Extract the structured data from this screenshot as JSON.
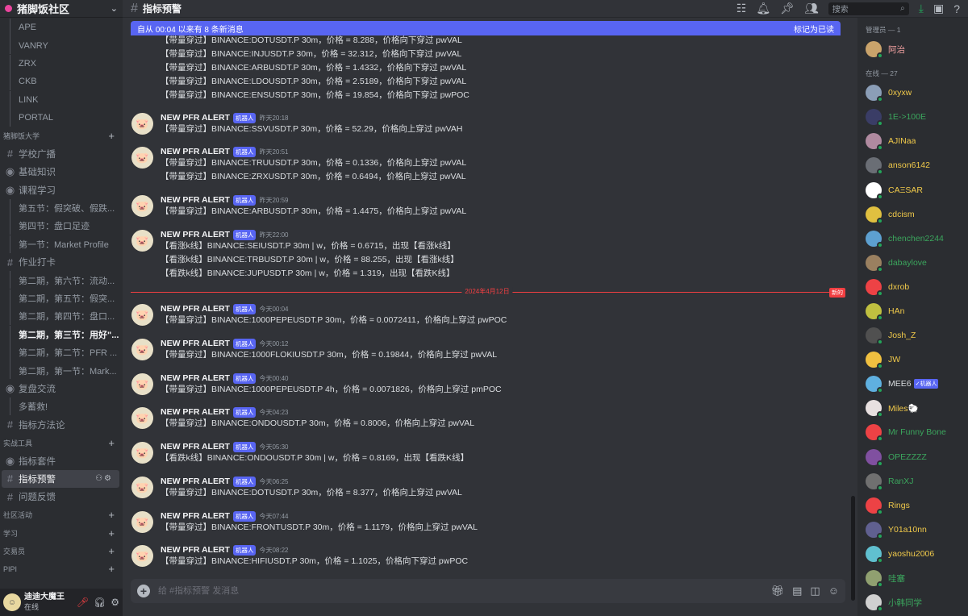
{
  "server": {
    "name": "猪脚饭社区"
  },
  "channels": [
    {
      "kind": "sub",
      "label": "APE"
    },
    {
      "kind": "sub",
      "label": "VANRY"
    },
    {
      "kind": "sub",
      "label": "ZRX"
    },
    {
      "kind": "sub",
      "label": "CKB"
    },
    {
      "kind": "sub",
      "label": "LINK"
    },
    {
      "kind": "sub",
      "label": "PORTAL"
    },
    {
      "kind": "cat",
      "label": "猪脚饭大学"
    },
    {
      "kind": "ch",
      "icon": "#",
      "label": "学校广播"
    },
    {
      "kind": "ch",
      "icon": "◉",
      "label": "基础知识"
    },
    {
      "kind": "ch",
      "icon": "◉",
      "label": "课程学习"
    },
    {
      "kind": "sub",
      "label": "第五节：假突破、假跌..."
    },
    {
      "kind": "sub",
      "label": "第四节：盘口足迹"
    },
    {
      "kind": "sub",
      "label": "第一节：Market Profile"
    },
    {
      "kind": "ch",
      "icon": "#",
      "label": "作业打卡"
    },
    {
      "kind": "sub",
      "label": "第二期，第六节：流动..."
    },
    {
      "kind": "sub",
      "label": "第二期，第五节：假突..."
    },
    {
      "kind": "sub",
      "label": "第二期，第四节：盘口..."
    },
    {
      "kind": "subb",
      "label": "第二期，第三节：用好\"..."
    },
    {
      "kind": "sub",
      "label": "第二期，第二节：PFR ..."
    },
    {
      "kind": "sub",
      "label": "第二期，第一节：Mark..."
    },
    {
      "kind": "ch",
      "icon": "◉",
      "label": "复盘交流"
    },
    {
      "kind": "sub",
      "label": "多蓄救!"
    },
    {
      "kind": "ch",
      "icon": "#",
      "label": "指标方法论"
    },
    {
      "kind": "cat",
      "label": "实战工具"
    },
    {
      "kind": "ch",
      "icon": "◉",
      "label": "指标套件"
    },
    {
      "kind": "sel",
      "icon": "#",
      "label": "指标预警"
    },
    {
      "kind": "ch",
      "icon": "#",
      "label": "问题反馈"
    },
    {
      "kind": "cat",
      "label": "社区活动"
    },
    {
      "kind": "cat",
      "label": "学习"
    },
    {
      "kind": "cat",
      "label": "交易员"
    },
    {
      "kind": "cat",
      "label": "PIPI"
    }
  ],
  "user": {
    "name": "迪迪大魔王",
    "status": "在线"
  },
  "topbar": {
    "channel": "指标预警",
    "search_placeholder": "搜索"
  },
  "banner": {
    "text": "自从 00:04 以来有 8 条新消息",
    "action": "标记为已读"
  },
  "bot_tag": "机器人",
  "top_lines": [
    "【带量穿过】BINANCE:DOTUSDT.P 30m，价格 = 8.288，价格向下穿过 pwVAL",
    "【带量穿过】BINANCE:INJUSDT.P 30m，价格 = 32.312，价格向下穿过 pwVAL",
    "【带量穿过】BINANCE:ARBUSDT.P 30m，价格 = 1.4332，价格向下穿过 pwVAL",
    "【带量穿过】BINANCE:LDOUSDT.P 30m，价格 = 2.5189，价格向下穿过 pwVAL",
    "【带量穿过】BINANCE:ENSUSDT.P 30m，价格 = 19.854，价格向下穿过 pwPOC"
  ],
  "messages": [
    {
      "author": "NEW PFR ALERT",
      "time": "昨天20:18",
      "lines": [
        "【带量穿过】BINANCE:SSVUSDT.P 30m，价格 = 52.29，价格向上穿过 pwVAH"
      ]
    },
    {
      "author": "NEW PFR ALERT",
      "time": "昨天20:51",
      "lines": [
        "【带量穿过】BINANCE:TRUUSDT.P 30m，价格 = 0.1336，价格向上穿过 pwVAL",
        "【带量穿过】BINANCE:ZRXUSDT.P 30m，价格 = 0.6494，价格向上穿过 pwVAL"
      ]
    },
    {
      "author": "NEW PFR ALERT",
      "time": "昨天20:59",
      "lines": [
        "【带量穿过】BINANCE:ARBUSDT.P 30m，价格 = 1.4475，价格向上穿过 pwVAL"
      ]
    },
    {
      "author": "NEW PFR ALERT",
      "time": "昨天22:00",
      "lines": [
        "【看涨k线】BINANCE:SEIUSDT.P 30m | w，价格 = 0.6715，出现【看涨k线】",
        "【看涨k线】BINANCE:TRBUSDT.P 30m | w，价格 = 88.255，出现【看涨k线】",
        "【看跌k线】BINANCE:JUPUSDT.P 30m | w，价格 = 1.319，出现【看跌K线】"
      ]
    },
    {
      "author": "NEW PFR ALERT",
      "time": "今天00:04",
      "lines": [
        "【带量穿过】BINANCE:1000PEPEUSDT.P 30m，价格 = 0.0072411，价格向上穿过 pwPOC"
      ]
    },
    {
      "author": "NEW PFR ALERT",
      "time": "今天00:12",
      "lines": [
        "【带量穿过】BINANCE:1000FLOKIUSDT.P 30m，价格 = 0.19844，价格向上穿过 pwVAL"
      ]
    },
    {
      "author": "NEW PFR ALERT",
      "time": "今天00:40",
      "lines": [
        "【带量穿过】BINANCE:1000PEPEUSDT.P 4h，价格 = 0.0071826，价格向上穿过 pmPOC"
      ]
    },
    {
      "author": "NEW PFR ALERT",
      "time": "今天04:23",
      "lines": [
        "【带量穿过】BINANCE:ONDOUSDT.P 30m，价格 = 0.8006，价格向上穿过 pwVAL"
      ]
    },
    {
      "author": "NEW PFR ALERT",
      "time": "今天05:30",
      "lines": [
        "【看跌k线】BINANCE:ONDOUSDT.P 30m | w，价格 = 0.8169，出现【看跌K线】"
      ]
    },
    {
      "author": "NEW PFR ALERT",
      "time": "今天06:25",
      "lines": [
        "【带量穿过】BINANCE:DOTUSDT.P 30m，价格 = 8.377，价格向上穿过 pwVAL"
      ]
    },
    {
      "author": "NEW PFR ALERT",
      "time": "今天07:44",
      "lines": [
        "【带量穿过】BINANCE:FRONTUSDT.P 30m，价格 = 1.1179，价格向上穿过 pwVAL"
      ]
    },
    {
      "author": "NEW PFR ALERT",
      "time": "今天08:22",
      "lines": [
        "【带量穿过】BINANCE:HIFIUSDT.P 30m，价格 = 1.1025，价格向下穿过 pwPOC"
      ]
    }
  ],
  "divider": {
    "date": "2024年4月12日",
    "badge": "新的"
  },
  "composer": {
    "placeholder": "给 #指标预警 发消息"
  },
  "members": {
    "admin_header": "管理员 — 1",
    "admins": [
      {
        "name": "阿治",
        "color": "#f0a0a0",
        "bg": "#c9a36b"
      }
    ],
    "online_header": "在线 — 27",
    "online": [
      {
        "name": "0xyxw",
        "color": "#f0c94a",
        "bg": "#8b9eb7"
      },
      {
        "name": "1E->100E",
        "color": "#3ba55d",
        "bg": "#3a3d66"
      },
      {
        "name": "AJINaa",
        "color": "#f0c94a",
        "bg": "#b08aa0"
      },
      {
        "name": "anson6142",
        "color": "#f0c94a",
        "bg": "#6a6e75"
      },
      {
        "name": "CAΞSAR",
        "color": "#f0c94a",
        "bg": "#ffffff"
      },
      {
        "name": "cdcism",
        "color": "#f0c94a",
        "bg": "#e0c040"
      },
      {
        "name": "chenchen2244",
        "color": "#3ba55d",
        "bg": "#5da0d0"
      },
      {
        "name": "dabaylove",
        "color": "#3ba55d",
        "bg": "#9a8060"
      },
      {
        "name": "dxrob",
        "color": "#f0c94a",
        "bg": "#ed4245"
      },
      {
        "name": "HAn",
        "color": "#f0c94a",
        "bg": "#c0c040"
      },
      {
        "name": "Josh_Z",
        "color": "#f0c94a",
        "bg": "#505050"
      },
      {
        "name": "JW",
        "color": "#f0c94a",
        "bg": "#f0c040"
      },
      {
        "name": "MEE6",
        "color": "#dbdee1",
        "bg": "#5fb0e0",
        "tag": "✓机器人"
      },
      {
        "name": "Miles🐑",
        "color": "#f0c94a",
        "bg": "#e8e0e0"
      },
      {
        "name": "Mr Funny Bone",
        "color": "#3ba55d",
        "bg": "#ed4245"
      },
      {
        "name": "OPEZZZZ",
        "color": "#3ba55d",
        "bg": "#8050a0"
      },
      {
        "name": "RanXJ",
        "color": "#3ba55d",
        "bg": "#707070"
      },
      {
        "name": "Rings",
        "color": "#f0c94a",
        "bg": "#ed4245"
      },
      {
        "name": "Y01a10nn",
        "color": "#f0c94a",
        "bg": "#606090"
      },
      {
        "name": "yaoshu2006",
        "color": "#f0c94a",
        "bg": "#60c0d0"
      },
      {
        "name": "哇塞",
        "color": "#3ba55d",
        "bg": "#90a070"
      },
      {
        "name": "小韩同学",
        "color": "#3ba55d",
        "bg": "#d0d0d0"
      }
    ]
  },
  "colors": {
    "accent": "#5865f2",
    "divider": "#f23f42",
    "online": "#23a55a"
  }
}
